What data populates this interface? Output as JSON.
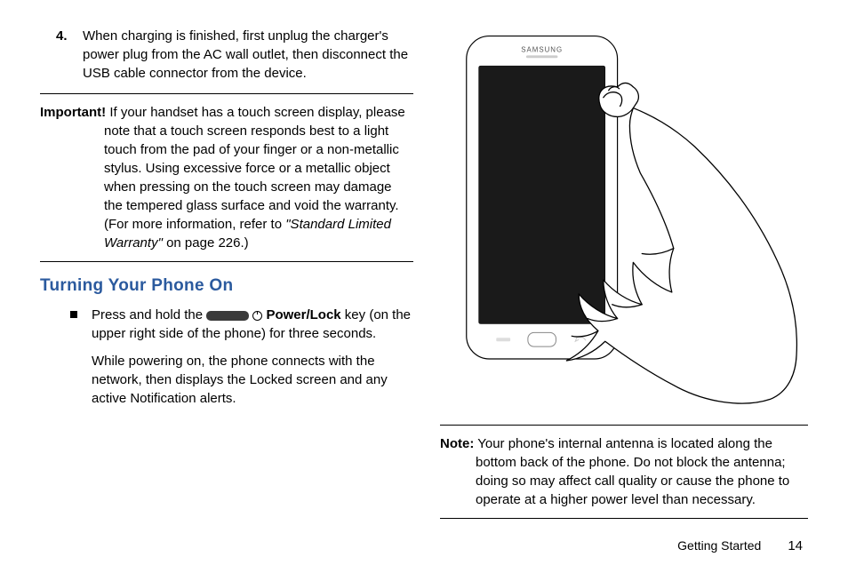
{
  "left": {
    "step4_num": "4.",
    "step4_text": "When charging is finished, first unplug the charger's power plug from the AC wall outlet, then disconnect the USB cable connector from the device.",
    "important_label": "Important!",
    "important_text_a": " If your handset has a touch screen display, please note that a touch screen responds best to a light touch from the pad of your finger or a non-metallic stylus. Using excessive force or a metallic object when pressing on the touch screen may damage the tempered glass surface and void the warranty. (For more information, refer to ",
    "important_text_italic": "\"Standard Limited Warranty\"",
    "important_text_b": " on page 226.)",
    "heading": "Turning Your Phone On",
    "bullet1_a": "Press and hold the ",
    "bullet1_key": "Power/Lock",
    "bullet1_b": " key (on the upper right side of the phone) for three seconds.",
    "bullet1_para2": "While powering on, the phone connects with the network, then displays the Locked screen and any active Notification alerts."
  },
  "right": {
    "phone_brand": "SAMSUNG",
    "note_label": "Note:",
    "note_text": " Your phone's internal antenna is located along the bottom back of the phone. Do not block the antenna; doing so may affect call quality or cause the phone to operate at a higher power level than necessary."
  },
  "footer": {
    "section": "Getting Started",
    "page": "14"
  }
}
